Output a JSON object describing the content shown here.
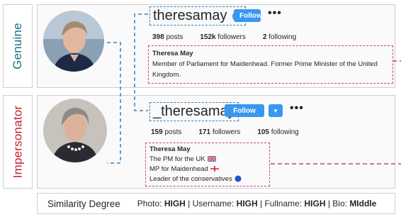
{
  "labels": {
    "genuine": "Genuine",
    "impersonator": "Impersonator"
  },
  "genuine": {
    "username": "theresamay",
    "verified": true,
    "follow_label": "Follow",
    "more": "•••",
    "posts_count": "398",
    "posts_label": "posts",
    "followers_count": "152k",
    "followers_label": "followers",
    "following_count": "2",
    "following_label": "following",
    "bio_name": "Theresa May",
    "bio_text": "Member of Parliament for Maidenhead. Former Prime Minister of the United Kingdom."
  },
  "impersonator": {
    "username": "_theresamay",
    "follow_label": "Follow",
    "more": "•••",
    "posts_count": "159",
    "posts_label": "posts",
    "followers_count": "171",
    "followers_label": "followers",
    "following_count": "105",
    "following_label": "following",
    "bio_name": "Theresa May",
    "bio_line1": "The PM for the UK",
    "bio_line2": "MP for Maidenhead",
    "bio_line3": "Leader of the conservatives"
  },
  "similarity": {
    "title": "Similarity Degree",
    "photo_label": "Photo:",
    "photo_value": "HIGH",
    "username_label": "| Username:",
    "username_value": "HIGH",
    "fullname_label": "| Fullname:",
    "fullname_value": "HIGH",
    "bio_label": "| Bio:",
    "bio_value": "MIddle"
  },
  "colors": {
    "genuine_label": "#1a6e84",
    "impersonator_label": "#c8202a",
    "follow_button": "#3897f0",
    "username_dash": "#3b7fb8",
    "bio_dash": "#c0477c"
  }
}
